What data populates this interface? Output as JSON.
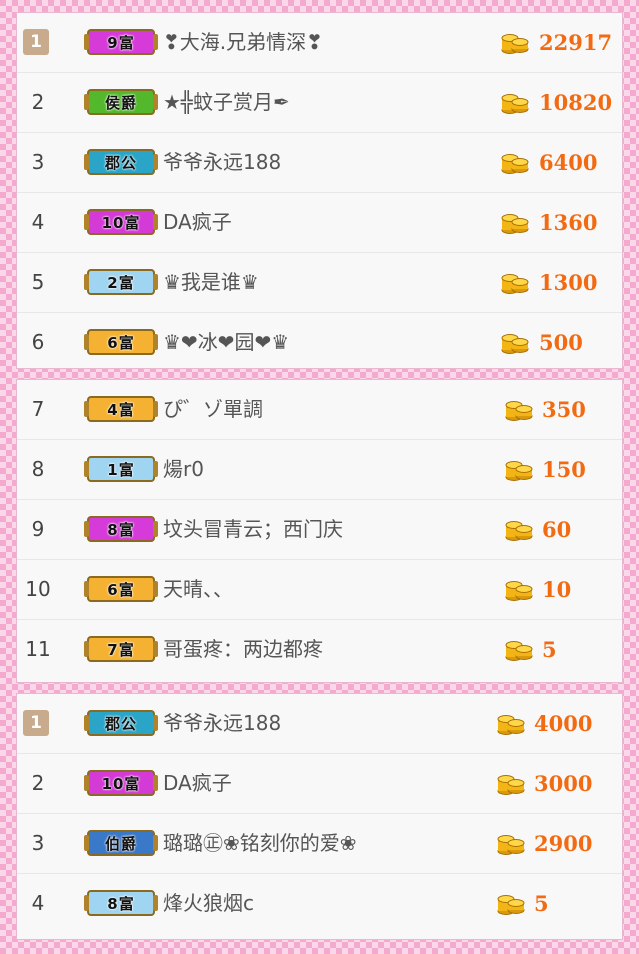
{
  "panels": [
    {
      "rows": [
        {
          "rank": "1",
          "highlight": true,
          "title": "9富",
          "title_color": "#d63bd9",
          "name": "❣大海.兄弟情深❣",
          "score": "22917"
        },
        {
          "rank": "2",
          "highlight": false,
          "title": "侯爵",
          "title_color": "#53b82c",
          "name": "★╬蚊子赏月✒",
          "score": "10820"
        },
        {
          "rank": "3",
          "highlight": false,
          "title": "郡公",
          "title_color": "#2aa5c8",
          "name": "爷爷永远188",
          "score": "6400"
        },
        {
          "rank": "4",
          "highlight": false,
          "title": "10富",
          "title_color": "#d43ad6",
          "name": "DA疯子",
          "score": "1360"
        },
        {
          "rank": "5",
          "highlight": false,
          "title": "2富",
          "title_color": "#9fd5f0",
          "name": "♛我是谁♛",
          "score": "1300"
        },
        {
          "rank": "6",
          "highlight": false,
          "title": "6富",
          "title_color": "#f5b232",
          "name": "♛❤冰❤园❤♛",
          "score": "500"
        }
      ]
    },
    {
      "rows": [
        {
          "rank": "7",
          "highlight": false,
          "title": "4富",
          "title_color": "#f5b232",
          "name": "ぴ゛ゾ單調",
          "score": "350"
        },
        {
          "rank": "8",
          "highlight": false,
          "title": "1富",
          "title_color": "#9fd5f0",
          "name": "煬r0",
          "score": "150"
        },
        {
          "rank": "9",
          "highlight": false,
          "title": "8富",
          "title_color": "#d63bd9",
          "name": "坟头冒青云；西门庆",
          "score": "60"
        },
        {
          "rank": "10",
          "highlight": false,
          "title": "6富",
          "title_color": "#f5b232",
          "name": "天晴、、",
          "score": "10"
        },
        {
          "rank": "11",
          "highlight": false,
          "title": "7富",
          "title_color": "#f5b232",
          "name": "哥蛋疼：两边都疼",
          "score": "5"
        }
      ]
    },
    {
      "rows": [
        {
          "rank": "1",
          "highlight": true,
          "title": "郡公",
          "title_color": "#2aa5c8",
          "name": "爷爷永远188",
          "score": "4000"
        },
        {
          "rank": "2",
          "highlight": false,
          "title": "10富",
          "title_color": "#d43ad6",
          "name": "DA疯子",
          "score": "3000"
        },
        {
          "rank": "3",
          "highlight": false,
          "title": "伯爵",
          "title_color": "#3a78c8",
          "name": "璐璐㊣❀铭刻你的爱❀",
          "score": "2900"
        },
        {
          "rank": "4",
          "highlight": false,
          "title": "8富",
          "title_color": "#9fd5f0",
          "name": "烽火狼烟c",
          "score": "5"
        }
      ]
    }
  ],
  "coin_icon": "gold-coins-icon",
  "colors": {
    "score": "#f26a12",
    "rank_badge": "#c8ab8d",
    "coin": "#f3b415"
  }
}
